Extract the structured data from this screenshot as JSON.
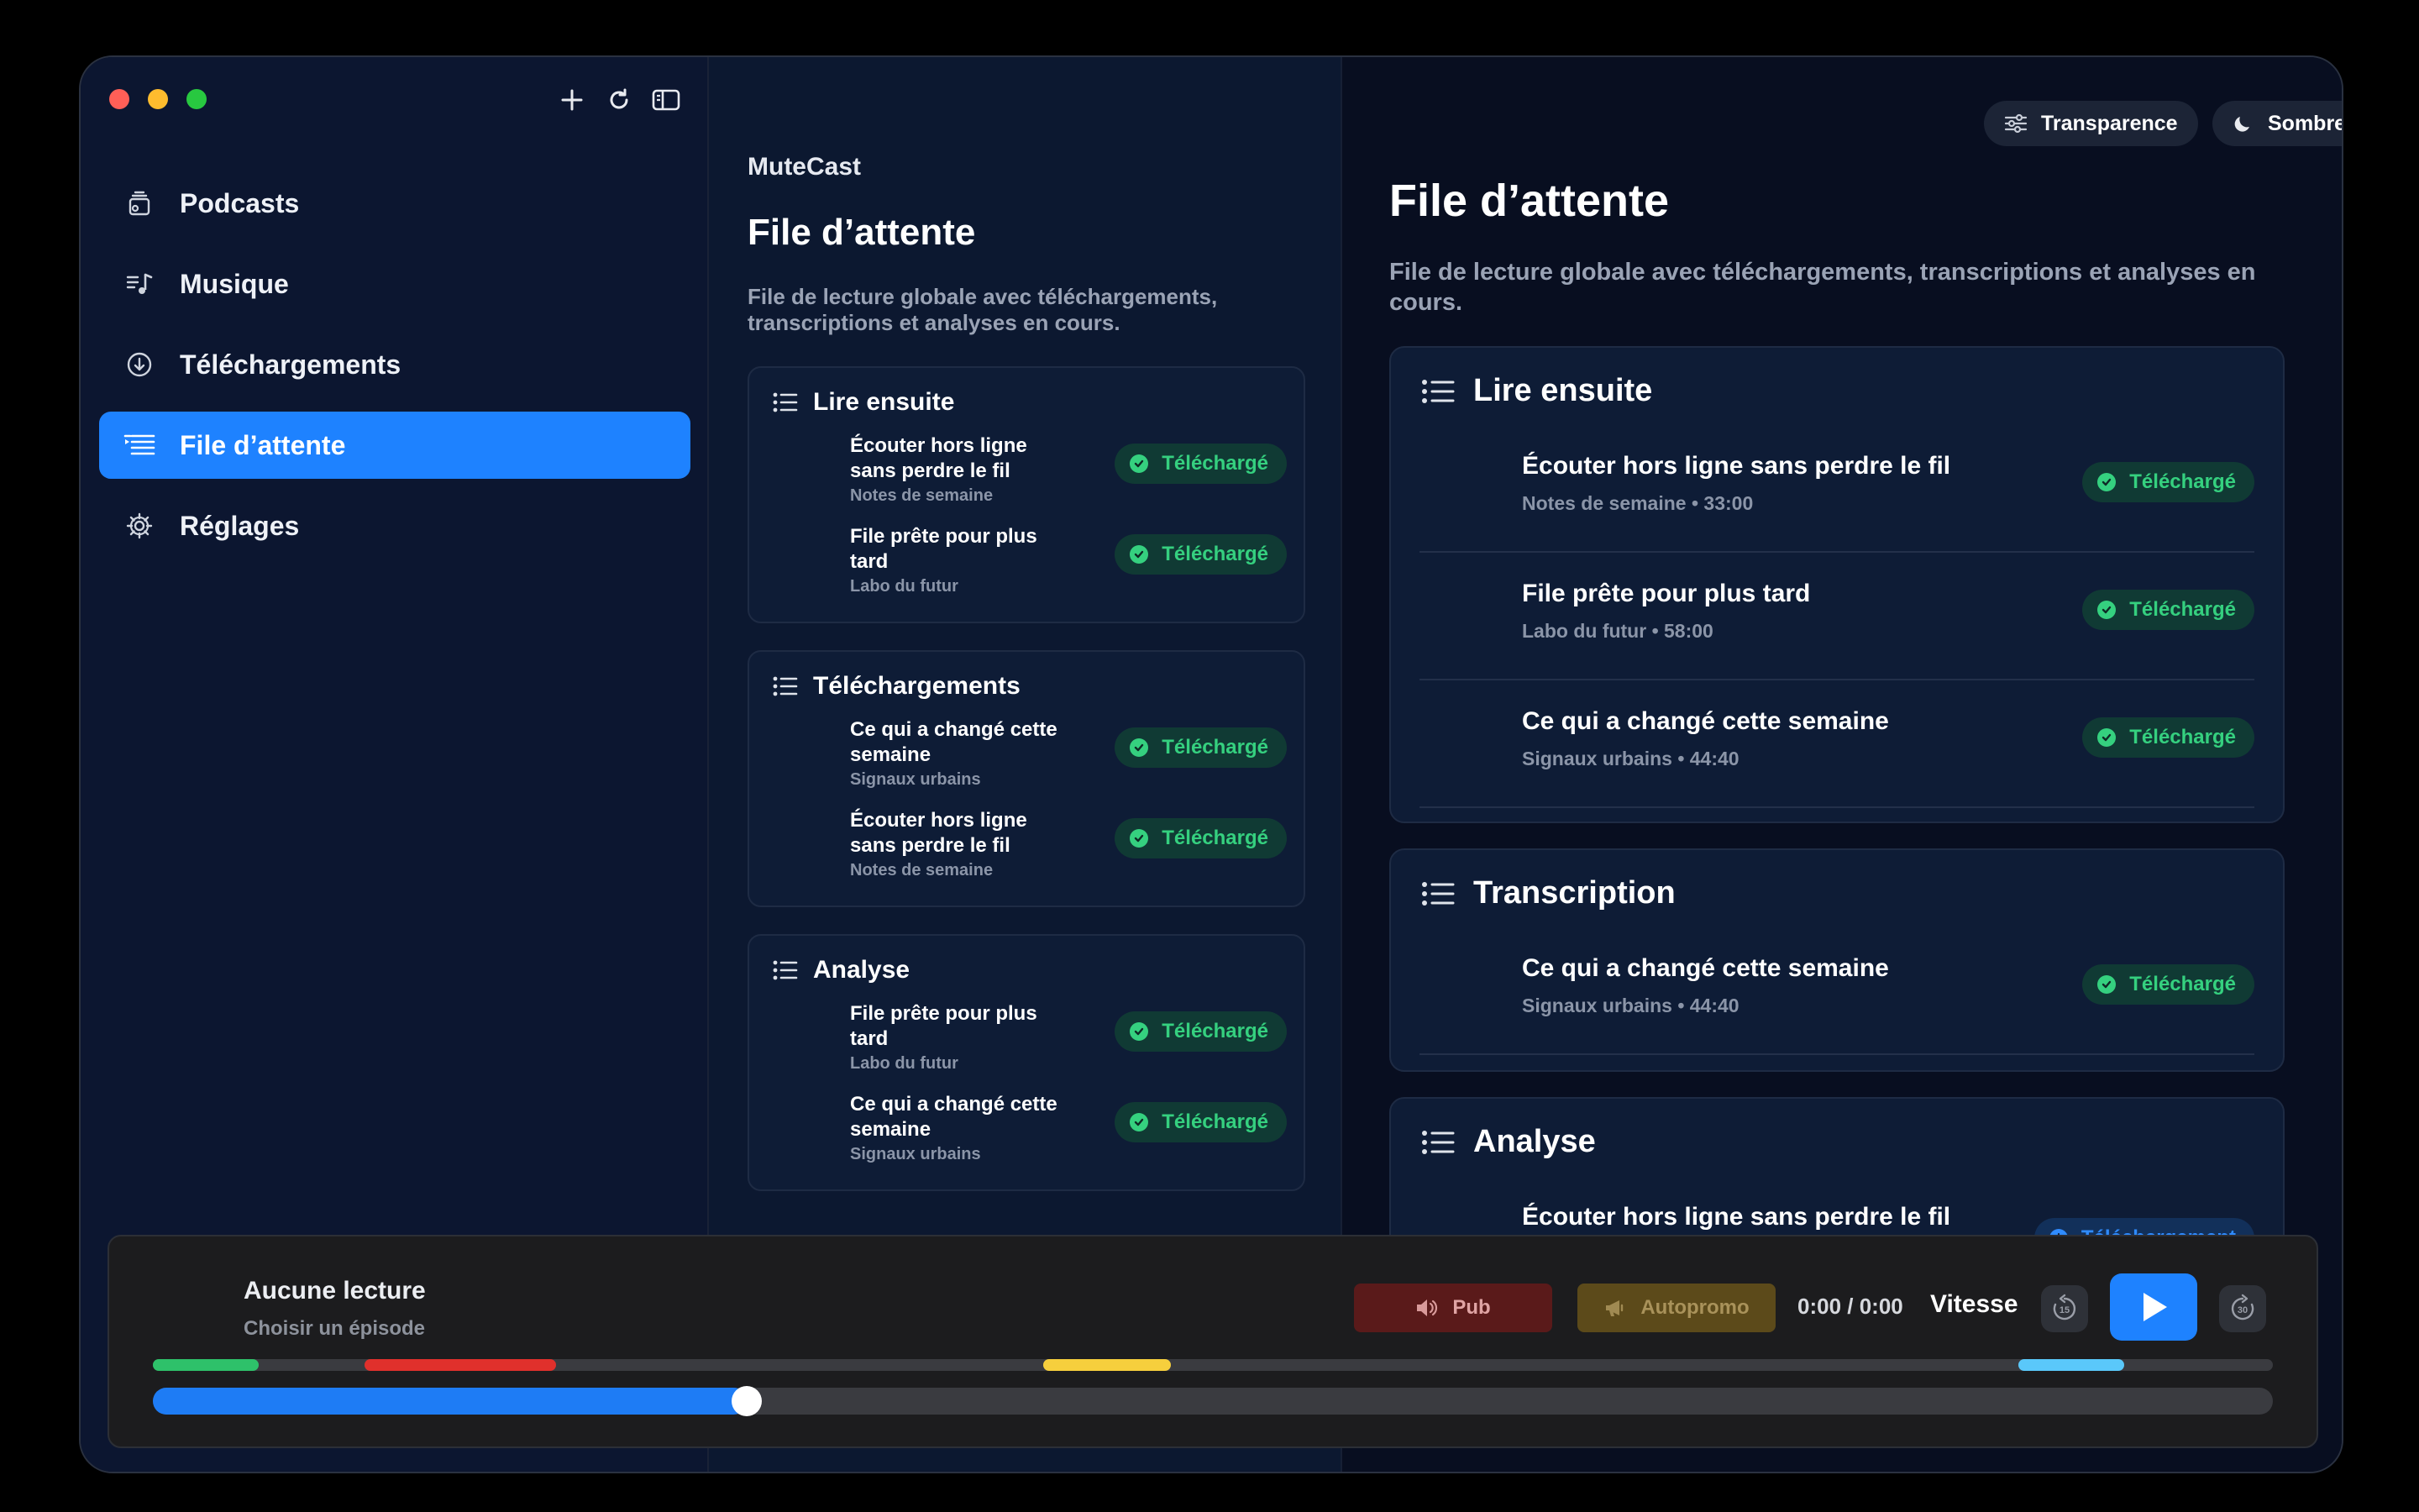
{
  "app": {
    "name": "MuteCast"
  },
  "sidebar": {
    "items": [
      {
        "label": "Podcasts",
        "icon": "podcasts-icon",
        "active": false
      },
      {
        "label": "Musique",
        "icon": "music-icon",
        "active": false
      },
      {
        "label": "Téléchargements",
        "icon": "download-icon",
        "active": false
      },
      {
        "label": "File d’attente",
        "icon": "queue-icon",
        "active": true
      },
      {
        "label": "Réglages",
        "icon": "gear-icon",
        "active": false
      }
    ]
  },
  "middle": {
    "app_name": "MuteCast",
    "title": "File d’attente",
    "description": "File de lecture globale avec téléchargements, transcriptions et analyses en cours.",
    "sections": [
      {
        "title": "Lire ensuite",
        "rows": [
          {
            "title": "Écouter hors ligne sans perdre le fil",
            "subtitle": "Notes de semaine",
            "status": "Téléchargé"
          },
          {
            "title": "File prête pour plus tard",
            "subtitle": "Labo du futur",
            "status": "Téléchargé"
          }
        ]
      },
      {
        "title": "Téléchargements",
        "rows": [
          {
            "title": "Ce qui a changé cette semaine",
            "subtitle": "Signaux urbains",
            "status": "Téléchargé"
          },
          {
            "title": "Écouter hors ligne sans perdre le fil",
            "subtitle": "Notes de semaine",
            "status": "Téléchargé"
          }
        ]
      },
      {
        "title": "Analyse",
        "rows": [
          {
            "title": "File prête pour plus tard",
            "subtitle": "Labo du futur",
            "status": "Téléchargé"
          },
          {
            "title": "Ce qui a changé cette semaine",
            "subtitle": "Signaux urbains",
            "status": "Téléchargé"
          }
        ]
      }
    ]
  },
  "right": {
    "transparency_label": "Transparence",
    "theme_label": "Sombre",
    "title": "File d’attente",
    "description": "File de lecture globale avec téléchargements, transcriptions et analyses en cours.",
    "sections": [
      {
        "title": "Lire ensuite",
        "rows": [
          {
            "title": "Écouter hors ligne sans perdre le fil",
            "subtitle": "Notes de semaine • 33:00",
            "status": "Téléchargé"
          },
          {
            "title": "File prête pour plus tard",
            "subtitle": "Labo du futur • 58:00",
            "status": "Téléchargé"
          },
          {
            "title": "Ce qui a changé cette semaine",
            "subtitle": "Signaux urbains • 44:40",
            "status": "Téléchargé"
          }
        ]
      },
      {
        "title": "Transcription",
        "rows": [
          {
            "title": "Ce qui a changé cette semaine",
            "subtitle": "Signaux urbains • 44:40",
            "status": "Téléchargé"
          }
        ]
      },
      {
        "title": "Analyse",
        "rows": [
          {
            "title": "Écouter hors ligne sans perdre le fil",
            "subtitle": "",
            "status": "Téléchargement"
          }
        ]
      }
    ]
  },
  "player": {
    "title": "Aucune lecture",
    "subtitle": "Choisir un épisode",
    "ad_label": "Pub",
    "self_promo_label": "Autopromo",
    "time": "0:00 / 0:00",
    "speed_label": "Vitesse",
    "skip_back_seconds": "15",
    "skip_forward_seconds": "30",
    "progress": 0.28,
    "segments": [
      {
        "color": "#2ec16a",
        "start": 0.0,
        "end": 0.05
      },
      {
        "color": "#e0302c",
        "start": 0.1,
        "end": 0.19
      },
      {
        "color": "#f6cf3d",
        "start": 0.42,
        "end": 0.48
      },
      {
        "color": "#5ac8fa",
        "start": 0.88,
        "end": 0.93
      }
    ]
  },
  "colors": {
    "accent": "#1e82ff",
    "success": "#35d07f",
    "ad": "#e0302c",
    "promo": "#f6cf3d"
  }
}
